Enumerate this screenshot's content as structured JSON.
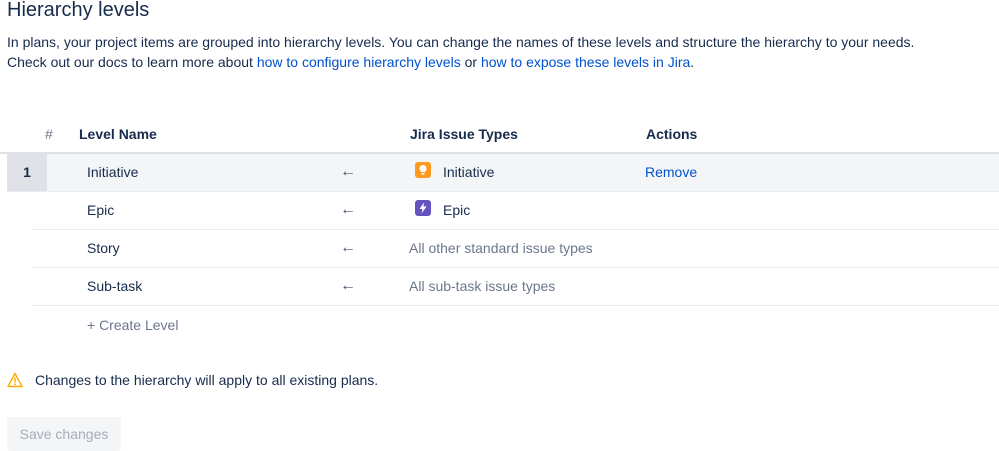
{
  "page": {
    "title": "Hierarchy levels",
    "desc_line1": "In plans, your project items are grouped into hierarchy levels. You can change the names of these levels and structure the hierarchy to your needs.",
    "desc_line2_prefix": "Check out our docs to learn more about ",
    "link_configure": "how to configure hierarchy levels",
    "desc_or": " or ",
    "link_expose": "how to expose these levels in Jira",
    "desc_end": "."
  },
  "table": {
    "headers": {
      "num": "#",
      "level_name": "Level Name",
      "issue_types": "Jira Issue Types",
      "actions": "Actions"
    },
    "rows": [
      {
        "num": "1",
        "name": "Initiative",
        "arrow": "←",
        "issue": "Initiative",
        "icon": "initiative-icon",
        "action": "Remove"
      },
      {
        "name": "Epic",
        "arrow": "←",
        "issue": "Epic",
        "icon": "epic-icon"
      },
      {
        "name": "Story",
        "arrow": "←",
        "issue": "All other standard issue types"
      },
      {
        "name": "Sub-task",
        "arrow": "←",
        "issue": "All sub-task issue types"
      }
    ],
    "create_level": "+ Create Level"
  },
  "warning": {
    "text": "Changes to the hierarchy will apply to all existing plans.",
    "icon": "warning-icon"
  },
  "save_button": "Save changes",
  "colors": {
    "link": "#0052cc",
    "initiative": "#ff991f",
    "epic": "#6554c0",
    "warning": "#ffab00"
  }
}
